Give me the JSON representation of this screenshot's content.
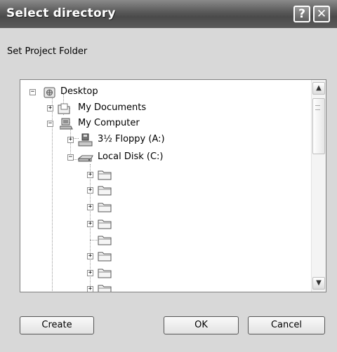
{
  "window": {
    "title": "Select directory",
    "help_label": "?",
    "close_label": "✕"
  },
  "prompt": "Set Project Folder",
  "tree": {
    "nodes": [
      {
        "label": "Desktop",
        "icon": "desktop-icon",
        "expander": "−"
      },
      {
        "label": "My Documents",
        "icon": "my-documents-icon",
        "expander": "+"
      },
      {
        "label": "My Computer",
        "icon": "my-computer-icon",
        "expander": "−"
      },
      {
        "label": "3½ Floppy (A:)",
        "icon": "floppy-drive-icon",
        "expander": "+"
      },
      {
        "label": "Local Disk (C:)",
        "icon": "local-disk-icon",
        "expander": "−"
      },
      {
        "label": "",
        "icon": "folder-icon",
        "expander": "+"
      },
      {
        "label": "",
        "icon": "folder-icon",
        "expander": "+"
      },
      {
        "label": "",
        "icon": "folder-icon",
        "expander": "+"
      },
      {
        "label": "",
        "icon": "folder-icon",
        "expander": "+"
      },
      {
        "label": "",
        "icon": "folder-icon",
        "expander": ""
      },
      {
        "label": "",
        "icon": "folder-icon",
        "expander": "+"
      },
      {
        "label": "",
        "icon": "folder-icon",
        "expander": "+"
      },
      {
        "label": "",
        "icon": "folder-icon",
        "expander": "+"
      }
    ]
  },
  "scrollbar": {
    "up_icon": "scroll-up-arrow-icon",
    "down_icon": "scroll-down-arrow-icon",
    "up_glyph": "▲",
    "down_glyph": "▼"
  },
  "buttons": {
    "create": "Create",
    "ok": "OK",
    "cancel": "Cancel"
  }
}
